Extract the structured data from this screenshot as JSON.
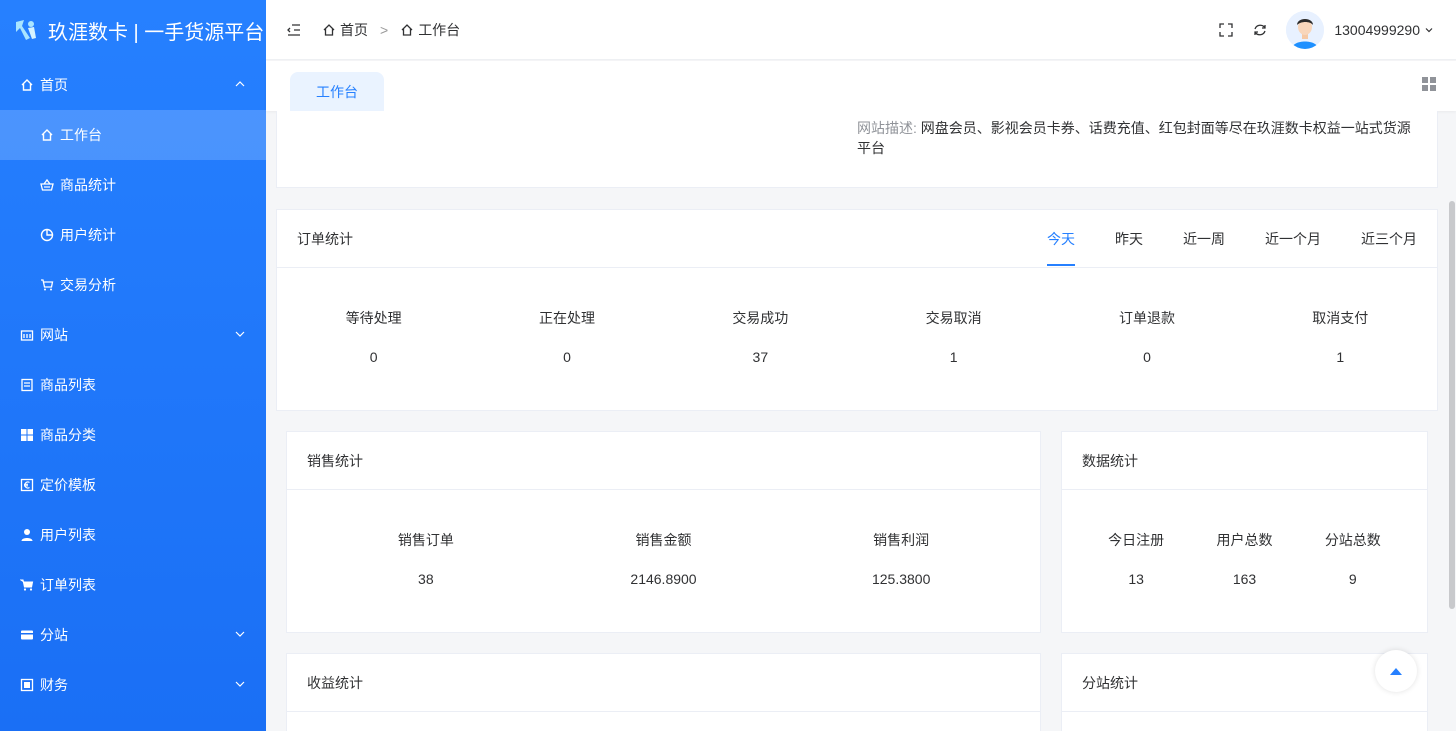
{
  "app": {
    "title": "玖涯数卡 | 一手货源平台"
  },
  "colors": {
    "accent": "#2680ff",
    "sidebar": "#1a6ff5"
  },
  "sidebar": {
    "items": [
      {
        "label": "首页",
        "icon": "home-icon",
        "expanded": true
      },
      {
        "label": "工作台",
        "icon": "home-icon",
        "sub": true,
        "active": true
      },
      {
        "label": "商品统计",
        "icon": "basket-icon",
        "sub": true
      },
      {
        "label": "用户统计",
        "icon": "pie-chart-icon",
        "sub": true
      },
      {
        "label": "交易分析",
        "icon": "cart-icon",
        "sub": true
      },
      {
        "label": "网站",
        "icon": "bank-icon",
        "expandable": true
      },
      {
        "label": "商品列表",
        "icon": "list-doc-icon"
      },
      {
        "label": "商品分类",
        "icon": "grid-icon"
      },
      {
        "label": "定价模板",
        "icon": "euro-icon"
      },
      {
        "label": "用户列表",
        "icon": "user-icon"
      },
      {
        "label": "订单列表",
        "icon": "cart-icon"
      },
      {
        "label": "分站",
        "icon": "card-icon",
        "expandable": true
      },
      {
        "label": "财务",
        "icon": "finance-icon",
        "expandable": true
      }
    ]
  },
  "header": {
    "breadcrumb": [
      "首页",
      "工作台"
    ],
    "username": "13004999290"
  },
  "tabs": [
    {
      "label": "工作台"
    }
  ],
  "description": {
    "label": "网站描述:",
    "text": "网盘会员、影视会员卡券、话费充值、红包封面等尽在玖涯数卡权益一站式货源平台"
  },
  "orders": {
    "title": "订单统计",
    "ranges": [
      "今天",
      "昨天",
      "近一周",
      "近一个月",
      "近三个月"
    ],
    "active_range": "今天",
    "stats": [
      {
        "label": "等待处理",
        "value": "0"
      },
      {
        "label": "正在处理",
        "value": "0"
      },
      {
        "label": "交易成功",
        "value": "37"
      },
      {
        "label": "交易取消",
        "value": "1"
      },
      {
        "label": "订单退款",
        "value": "0"
      },
      {
        "label": "取消支付",
        "value": "1"
      }
    ]
  },
  "sales": {
    "title": "销售统计",
    "stats": [
      {
        "label": "销售订单",
        "value": "38"
      },
      {
        "label": "销售金额",
        "value": "2146.8900"
      },
      {
        "label": "销售利润",
        "value": "125.3800"
      }
    ]
  },
  "data_stats": {
    "title": "数据统计",
    "stats": [
      {
        "label": "今日注册",
        "value": "13"
      },
      {
        "label": "用户总数",
        "value": "163"
      },
      {
        "label": "分站总数",
        "value": "9"
      }
    ]
  },
  "income": {
    "title": "收益统计"
  },
  "branch": {
    "title": "分站统计"
  }
}
